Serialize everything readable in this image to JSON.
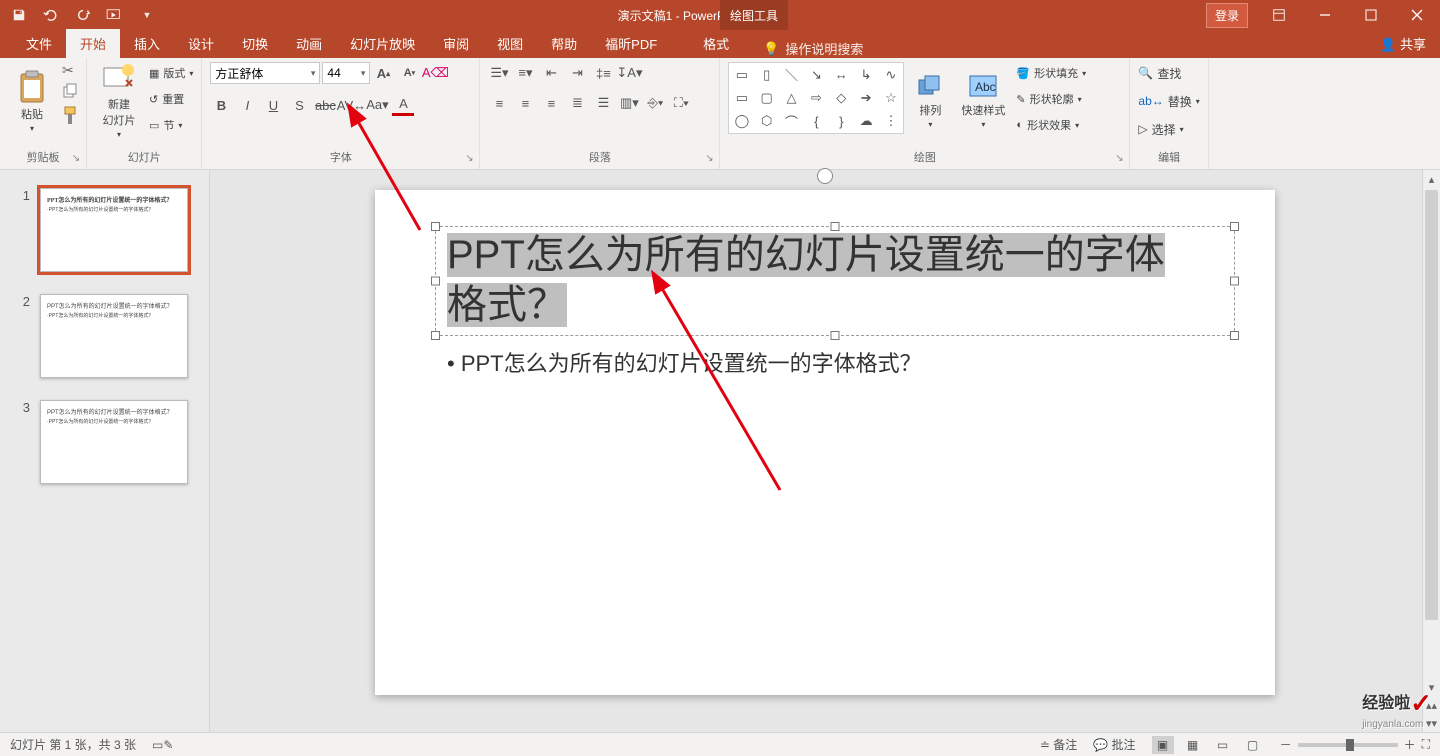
{
  "title": {
    "doc": "演示文稿1",
    "app": "PowerPoint",
    "sep": " - ",
    "tool_tab": "绘图工具"
  },
  "winbtns": {
    "login": "登录"
  },
  "tabs": {
    "file": "文件",
    "home": "开始",
    "insert": "插入",
    "design": "设计",
    "transition": "切换",
    "anim": "动画",
    "slideshow": "幻灯片放映",
    "review": "审阅",
    "view": "视图",
    "help": "帮助",
    "pdf": "福昕PDF",
    "format": "格式",
    "tellme": "操作说明搜索",
    "share": "共享"
  },
  "ribbon": {
    "clipboard": {
      "paste": "粘贴",
      "label": "剪贴板"
    },
    "slides": {
      "new": "新建\n幻灯片",
      "layout": "版式",
      "reset": "重置",
      "section": "节",
      "label": "幻灯片"
    },
    "font": {
      "name": "方正舒体",
      "size": "44",
      "label": "字体"
    },
    "para": {
      "label": "段落"
    },
    "draw": {
      "arrange": "排列",
      "quick": "快速样式",
      "fill": "形状填充",
      "outline": "形状轮廓",
      "effect": "形状效果",
      "label": "绘图"
    },
    "edit": {
      "find": "查找",
      "replace": "替换",
      "select": "选择",
      "label": "编辑"
    }
  },
  "slide": {
    "title_line1": "PPT怎么为所有的幻灯片设置统一的字体",
    "title_line2": "格式？",
    "body": "PPT怎么为所有的幻灯片设置统一的字体格式？"
  },
  "thumbs": {
    "t1": "PPT怎么为所有的幻灯片设置统一的字体格式？",
    "s1": "·PPT怎么为所有的幻灯片设置统一的字体格式？",
    "t2": "PPT怎么为所有的幻灯片设置统一的字体格式？",
    "s2": "·PPT怎么为所有的幻灯片设置统一的字体格式？",
    "t3": "PPT怎么为所有的幻灯片设置统一的字体格式？",
    "s3": "·PPT怎么为所有的幻灯片设置统一的字体格式？"
  },
  "status": {
    "slide": "幻灯片 第 1 张，共 3 张",
    "notes": "备注",
    "comments": "批注",
    "zoom_out": "－",
    "zoom_in": "＋"
  },
  "watermark": {
    "text": "经验啦",
    "url": "jingyanla.com"
  }
}
